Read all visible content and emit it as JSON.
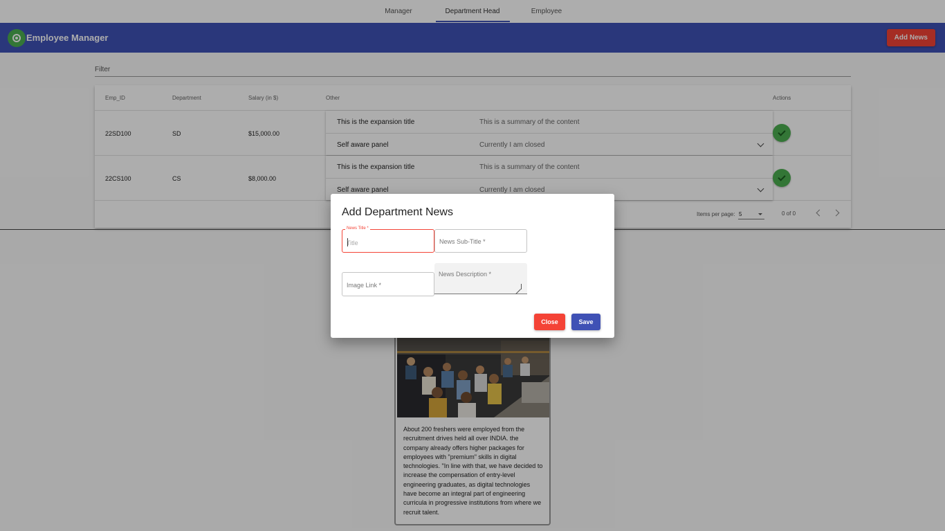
{
  "tabs": [
    {
      "label": "Manager"
    },
    {
      "label": "Department Head"
    },
    {
      "label": "Employee"
    }
  ],
  "appbar": {
    "logo_icon": "logo-icon",
    "title": "Employee Manager",
    "add_news_label": "Add News"
  },
  "filter": {
    "placeholder": "Filter"
  },
  "table": {
    "headers": [
      "Emp_ID",
      "Department",
      "Salary (in $)",
      "Other",
      "Actions"
    ],
    "rows": [
      {
        "emp_id": "22SD100",
        "department": "SD",
        "salary": "$15,000.00",
        "panel": {
          "title": "This is the expansion title",
          "summary": "This is a summary of the content",
          "self_title": "Self aware panel",
          "self_state": "Currently I am closed"
        },
        "action_icon": "check-icon"
      },
      {
        "emp_id": "22CS100",
        "department": "CS",
        "salary": "$8,000.00",
        "panel": {
          "title": "This is the expansion title",
          "summary": "This is a summary of the content",
          "self_title": "Self aware panel",
          "self_state": "Currently I am closed"
        },
        "action_icon": "check-icon"
      }
    ],
    "paginator": {
      "items_per_page_label": "Items per page:",
      "items_per_page_value": "5",
      "range_label": "0 of 0"
    }
  },
  "news_card": {
    "text": "About 200 freshers were employed from the recruitment drives held all over INDIA. the company already offers higher packages for employees with \"premium\" skills in digital technologies. \"In line with that, we have decided to increase the compensation of entry-level engineering graduates, as digital technologies have become an integral part of engineering curricula in progressive institutions from where we recruit talent."
  },
  "dialog": {
    "title": "Add Department News",
    "news_title_label": "News Title *",
    "news_title_placeholder": "Title",
    "news_subtitle_placeholder": "News Sub-Title *",
    "image_link_placeholder": "Image Link *",
    "news_description_placeholder": "News Description *",
    "close_label": "Close",
    "save_label": "Save"
  },
  "colors": {
    "primary": "#3f51b5",
    "warn": "#f44336",
    "success": "#4caf50"
  }
}
